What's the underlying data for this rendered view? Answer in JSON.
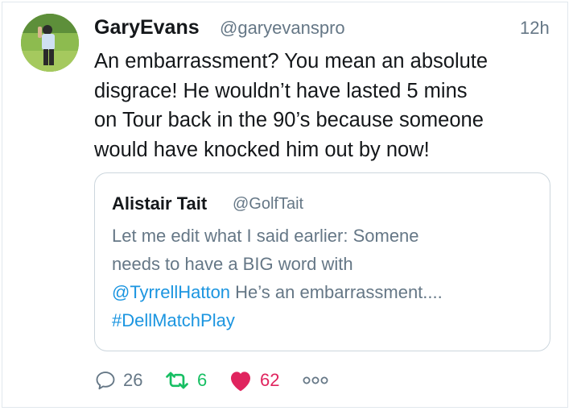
{
  "tweet": {
    "author_name": "GaryEvans",
    "author_handle": "@garyevanspro",
    "time": "12h",
    "text_lines": [
      "An embarrassment? You mean an absolute",
      "disgrace! He wouldn’t have lasted 5 mins",
      "on Tour back in the 90’s because someone",
      "would have knocked him out by now!"
    ]
  },
  "quoted": {
    "author_name": "Alistair Tait",
    "author_handle": "@GolfTait",
    "line1": "Let me edit what I said earlier: Somene",
    "line2": "needs to have a BIG word with",
    "mention": "@TyrrellHatton",
    "line3_rest": " He’s an embarrassment....",
    "hashtag": "#DellMatchPlay"
  },
  "actions": {
    "reply_count": "26",
    "retweet_count": "6",
    "like_count": "62",
    "more_glyph": "◦◦◦"
  },
  "colors": {
    "link": "#1b95e0",
    "retweet": "#17bf63",
    "like": "#e0245e",
    "muted": "#657786"
  },
  "icons": [
    "avatar-photo",
    "reply-icon",
    "retweet-icon",
    "heart-icon",
    "more-icon"
  ]
}
